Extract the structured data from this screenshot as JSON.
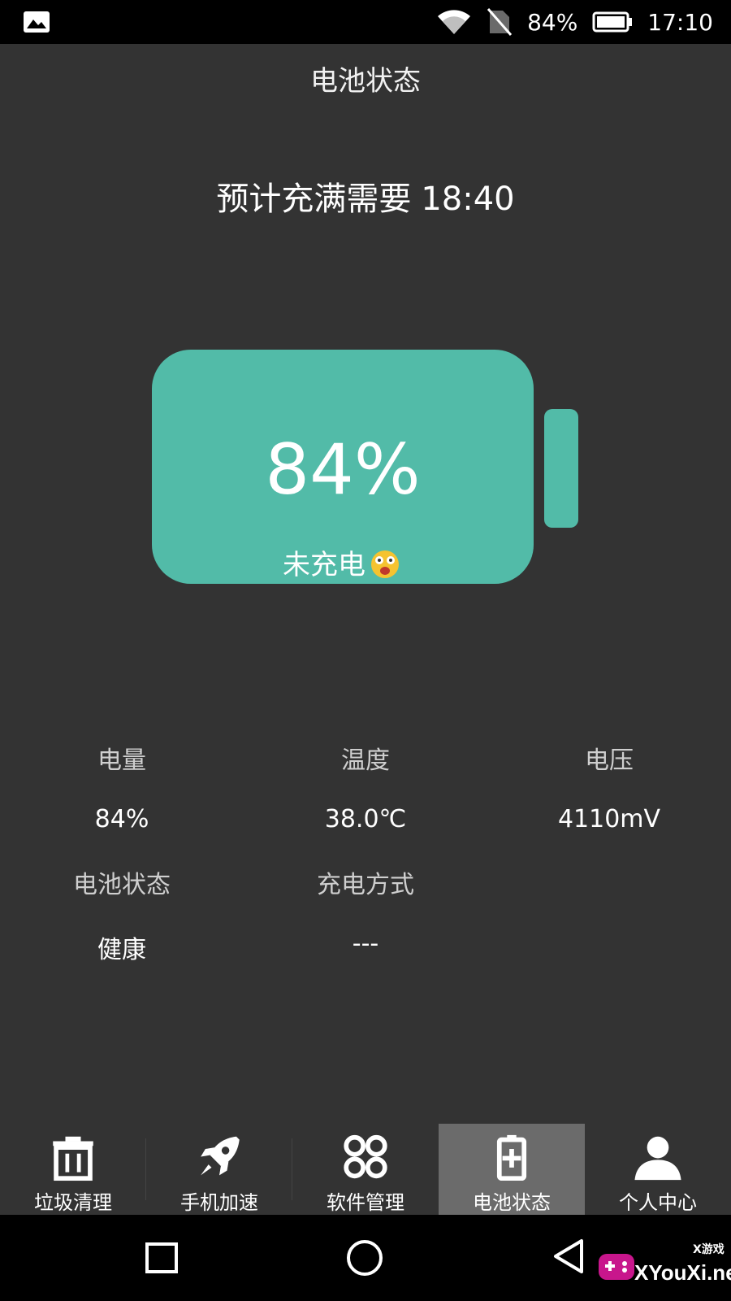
{
  "status_bar": {
    "battery_percent": "84%",
    "time": "17:10",
    "icons": [
      "gallery-icon",
      "wifi-icon",
      "no-sim-icon",
      "battery-icon"
    ]
  },
  "header": {
    "title": "电池状态"
  },
  "estimate": {
    "label": "预计充满需要",
    "value": "18:40"
  },
  "battery": {
    "percent_text": "84%",
    "status_text": "未充电",
    "color": "#52bba8",
    "level": 0.84
  },
  "stats": [
    {
      "key": "电量",
      "value": "84%"
    },
    {
      "key": "温度",
      "value": "38.0℃"
    },
    {
      "key": "电压",
      "value": "4110mV"
    },
    {
      "key": "电池状态",
      "value": "健康"
    },
    {
      "key": "充电方式",
      "value": "---"
    }
  ],
  "bottom_nav": {
    "items": [
      {
        "label": "垃圾清理",
        "icon": "trash-icon"
      },
      {
        "label": "手机加速",
        "icon": "rocket-icon"
      },
      {
        "label": "软件管理",
        "icon": "apps-icon"
      },
      {
        "label": "电池状态",
        "icon": "battery-plus-icon",
        "active": true
      },
      {
        "label": "个人中心",
        "icon": "user-icon"
      }
    ]
  },
  "system_nav": {
    "icons": [
      "recents-icon",
      "home-icon",
      "back-icon"
    ]
  },
  "watermark": {
    "site": "XYouXi.net",
    "tag": "X游戏"
  }
}
